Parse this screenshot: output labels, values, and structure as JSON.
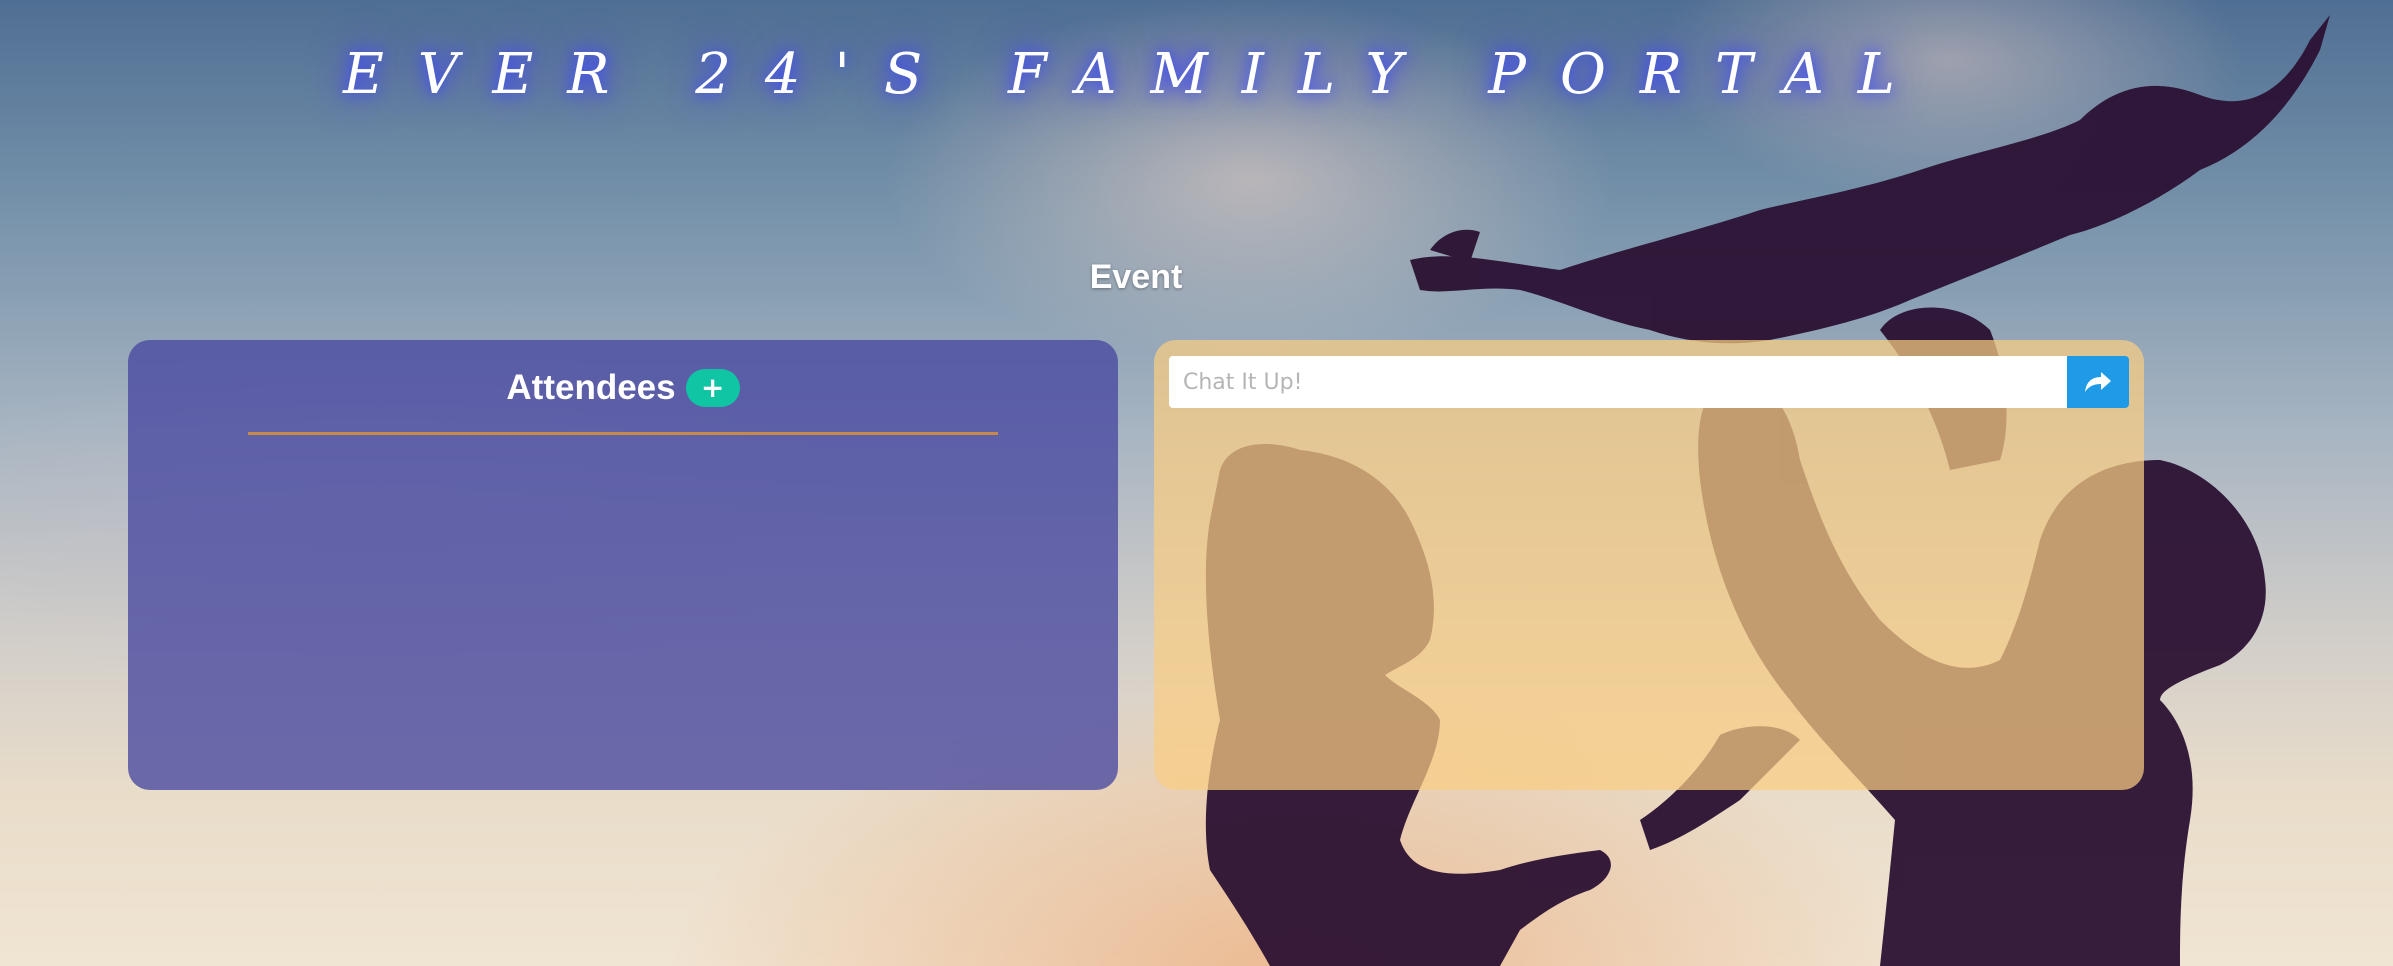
{
  "header": {
    "title": "EVER 24'S FAMILY PORTAL"
  },
  "event": {
    "section_title": "Event"
  },
  "attendees": {
    "title": "Attendees",
    "add_label": "+"
  },
  "chat": {
    "placeholder": "Chat It Up!",
    "value": "",
    "send_icon": "share-arrow-icon"
  },
  "colors": {
    "attendees_panel": "#4848a0",
    "chat_panel": "#facd82",
    "add_button": "#10c5a4",
    "send_button": "#1f9ae6",
    "divider": "#c78a4a"
  }
}
